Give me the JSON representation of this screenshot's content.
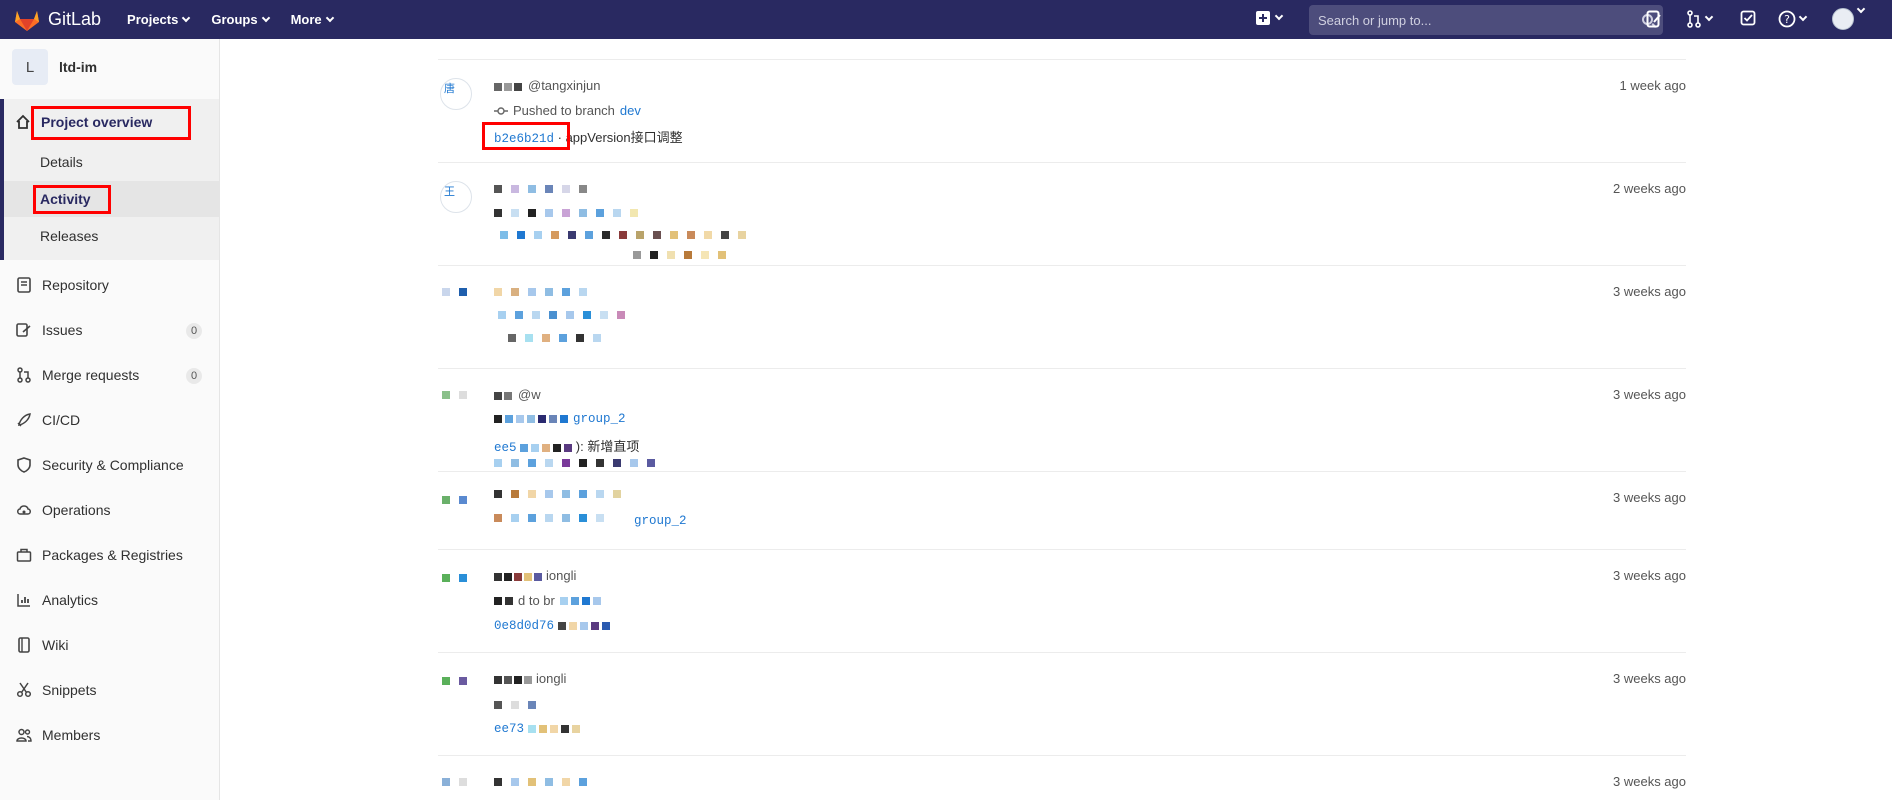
{
  "navbar": {
    "brand": "GitLab",
    "menu": [
      "Projects",
      "Groups",
      "More"
    ],
    "search_placeholder": "Search or jump to..."
  },
  "sidebar": {
    "project_letter": "L",
    "project_name": "ltd-im",
    "overview": "Project overview",
    "sub_items": [
      "Details",
      "Activity",
      "Releases"
    ],
    "items": [
      {
        "label": "Repository",
        "icon": "book-icon"
      },
      {
        "label": "Issues",
        "icon": "issues-icon",
        "badge": "0"
      },
      {
        "label": "Merge requests",
        "icon": "merge-request-icon",
        "badge": "0"
      },
      {
        "label": "CI/CD",
        "icon": "rocket-icon"
      },
      {
        "label": "Security & Compliance",
        "icon": "shield-icon"
      },
      {
        "label": "Operations",
        "icon": "cloud-gear-icon"
      },
      {
        "label": "Packages & Registries",
        "icon": "package-icon"
      },
      {
        "label": "Analytics",
        "icon": "chart-icon"
      },
      {
        "label": "Wiki",
        "icon": "book-closed-icon"
      },
      {
        "label": "Snippets",
        "icon": "scissors-icon"
      },
      {
        "label": "Members",
        "icon": "users-icon"
      }
    ]
  },
  "feed": {
    "events": [
      {
        "user": "唐",
        "handle": "@tangxinjun",
        "action": "Pushed to branch",
        "branch": "dev",
        "sha": "b2e6b21d",
        "commit": "· appVersion接口调整",
        "time": "1 week ago",
        "avatar_alt": "唐"
      },
      {
        "avatar_alt": "王",
        "time": "2 weeks ago"
      },
      {
        "time": "3 weeks ago"
      },
      {
        "time": "3 weeks ago",
        "handle": "@w",
        "tail": "group_2",
        "sha_prefix": "ee5",
        "commit_tail": "): 新增直项"
      },
      {
        "time": "3 weeks ago",
        "tail": "group_2"
      },
      {
        "time": "3 weeks ago",
        "handle_tail": "iongli",
        "action_tail": "d to br",
        "sha": "0e8d0d76"
      },
      {
        "time": "3 weeks ago",
        "handle_tail": "iongli",
        "sha_prefix": "ee73"
      },
      {
        "time": "3 weeks ago"
      }
    ]
  }
}
